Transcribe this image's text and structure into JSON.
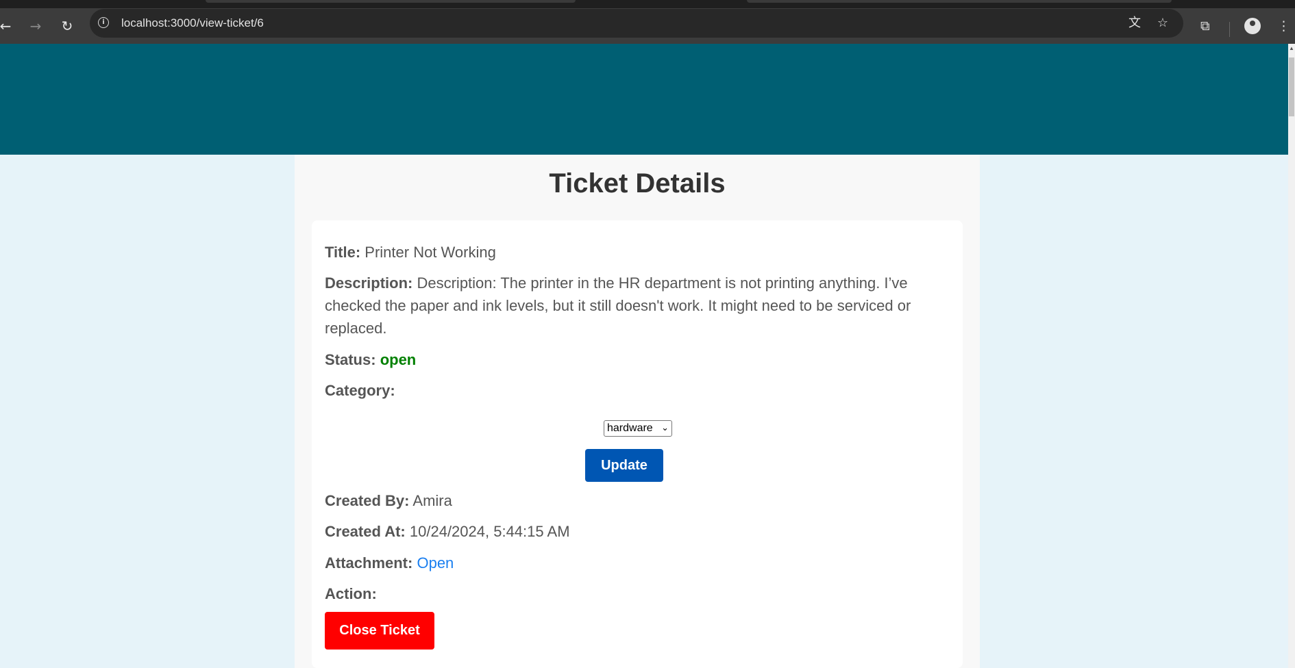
{
  "browser": {
    "url": "localhost:3000/view-ticket/6"
  },
  "page": {
    "heading": "Ticket Details",
    "colors": {
      "header_band": "#005f73",
      "background": "#e6f3f9",
      "status_open": "#008000",
      "update_button": "#0056b3",
      "close_button": "#ff0000",
      "link": "#1a7ff0"
    }
  },
  "ticket": {
    "title_label": "Title:",
    "title_value": "Printer Not Working",
    "description_label": "Description:",
    "description_value": "Description: The printer in the HR department is not printing anything. I’ve checked the paper and ink levels, but it still doesn't work. It might need to be serviced or replaced.",
    "status_label": "Status:",
    "status_value": "open",
    "category_label": "Category:",
    "category_selected": "hardware",
    "update_label": "Update",
    "created_by_label": "Created By:",
    "created_by_value": "Amira",
    "created_at_label": "Created At:",
    "created_at_value": "10/24/2024, 5:44:15 AM",
    "attachment_label": "Attachment:",
    "attachment_link": "Open",
    "action_label": "Action:",
    "close_label": "Close Ticket"
  }
}
